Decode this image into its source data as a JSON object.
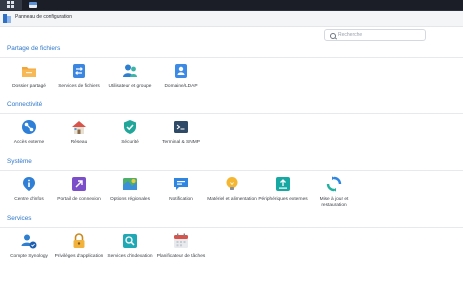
{
  "window": {
    "title": "Panneau de configuration"
  },
  "search": {
    "placeholder": "Recherche"
  },
  "sections": [
    {
      "title": "Partage de fichiers",
      "items": [
        {
          "label": "Dossier partagé",
          "icon": "folder-icon"
        },
        {
          "label": "Services de fichiers",
          "icon": "file-services-icon"
        },
        {
          "label": "Utilisateur et groupe",
          "icon": "users-icon"
        },
        {
          "label": "Domaine/LDAP",
          "icon": "domain-icon"
        }
      ]
    },
    {
      "title": "Connectivité",
      "items": [
        {
          "label": "Accès externe",
          "icon": "external-access-icon"
        },
        {
          "label": "Réseau",
          "icon": "network-house-icon"
        },
        {
          "label": "Sécurité",
          "icon": "security-shield-icon"
        },
        {
          "label": "Terminal & SNMP",
          "icon": "terminal-icon"
        }
      ]
    },
    {
      "title": "Système",
      "items": [
        {
          "label": "Centre d'infos",
          "icon": "info-center-icon"
        },
        {
          "label": "Portail de connexion",
          "icon": "login-portal-icon"
        },
        {
          "label": "Options régionales",
          "icon": "regional-map-icon"
        },
        {
          "label": "Notification",
          "icon": "notification-icon"
        },
        {
          "label": "Matériel et alimentation",
          "icon": "hardware-bulb-icon"
        },
        {
          "label": "Périphériques externes",
          "icon": "external-devices-icon"
        },
        {
          "label": "Mise à jour et restauration",
          "icon": "update-restore-icon"
        }
      ]
    },
    {
      "title": "Services",
      "items": [
        {
          "label": "Compte Synology",
          "icon": "synology-account-icon"
        },
        {
          "label": "Privilèges d'application",
          "icon": "app-privileges-lock-icon"
        },
        {
          "label": "Services d'indexation",
          "icon": "indexing-search-icon"
        },
        {
          "label": "Planificateur de tâches",
          "icon": "task-scheduler-calendar-icon"
        }
      ]
    }
  ],
  "colors": {
    "section_title": "#2f77c9",
    "taskbar": "#1b1e26",
    "titlebar": "#f4f5f7"
  }
}
